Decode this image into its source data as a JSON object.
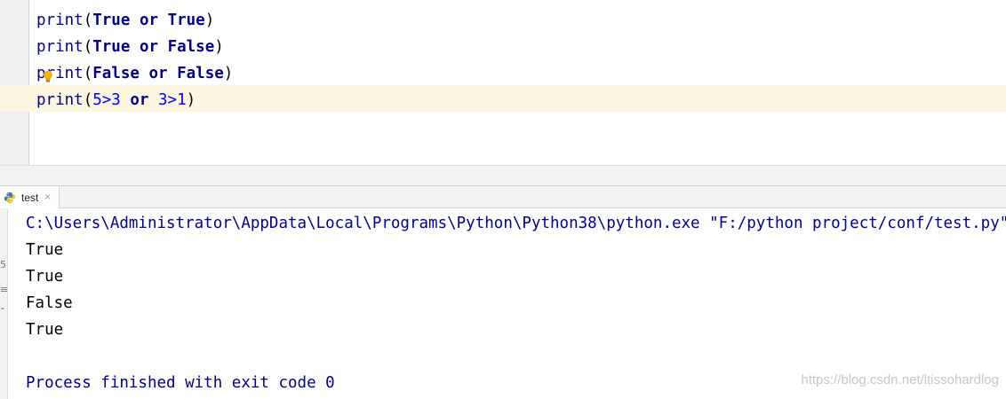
{
  "editor": {
    "lines": [
      {
        "fn": "print",
        "open": "(",
        "a": "True",
        "op": "or",
        "b": "True",
        "close": ")"
      },
      {
        "fn": "print",
        "open": "(",
        "a": "True",
        "op": "or",
        "b": "False",
        "close": ")"
      },
      {
        "fn": "print",
        "open": "(",
        "a": "False",
        "op": "or",
        "b": "False",
        "close": ")"
      },
      {
        "fn": "print",
        "open": "(",
        "a": "5>3",
        "op": "or",
        "b": "3>1",
        "close": ")"
      }
    ]
  },
  "run_tab": {
    "label": "test",
    "close": "×",
    "icon": "python-icon"
  },
  "console": {
    "command": "C:\\Users\\Administrator\\AppData\\Local\\Programs\\Python\\Python38\\python.exe \"F:/python project/conf/test.py\"",
    "output": [
      "True",
      "True",
      "False",
      "True"
    ],
    "blank": "",
    "process_msg": "Process finished with exit code 0"
  },
  "watermark": "https://blog.csdn.net/ltissohardlog",
  "colors": {
    "keyword": "#000080",
    "number": "#0000ff",
    "caret_line": "#fcf5df",
    "command": "#00008b",
    "bulb": "#f6b40e"
  }
}
